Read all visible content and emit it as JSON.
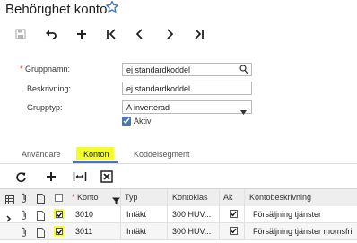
{
  "header": {
    "title": "Behörighet konto"
  },
  "toolbar": [
    "save-icon",
    "undo-icon",
    "add-icon",
    "first-icon",
    "previous-icon",
    "next-icon",
    "last-icon"
  ],
  "form": {
    "group_name_label": "Gruppnamn:",
    "group_name_value": "ej standardkoddel",
    "description_label": "Beskrivning:",
    "description_value": "ej standardkoddel",
    "group_type_label": "Grupptyp:",
    "group_type_value": "A inverterad",
    "active_label": "Aktiv",
    "active_checked": true
  },
  "tabs": [
    {
      "label": "Användare",
      "active": false
    },
    {
      "label": "Konton",
      "active": true
    },
    {
      "label": "Koddelsegment",
      "active": false
    }
  ],
  "grid": {
    "columns": {
      "konto": "Konto",
      "typ": "Typ",
      "kontoklass": "Kontoklas",
      "ak": "Ak",
      "kontobeskrivning": "Kontobeskrivning"
    },
    "rows": [
      {
        "konto": "3010",
        "typ": "Intäkt",
        "kontoklass": "300 HUV...",
        "kontobeskrivning": "Försäljning tjänster",
        "selected": true,
        "ak": true
      },
      {
        "konto": "3011",
        "typ": "Intäkt",
        "kontoklass": "300 HUV...",
        "kontobeskrivning": "Försäljning tjänster momsfri",
        "selected": true,
        "ak": true
      }
    ]
  },
  "colors": {
    "accent": "#4a76b9",
    "highlight": "#f3ff2a",
    "required": "#d43a2a"
  }
}
